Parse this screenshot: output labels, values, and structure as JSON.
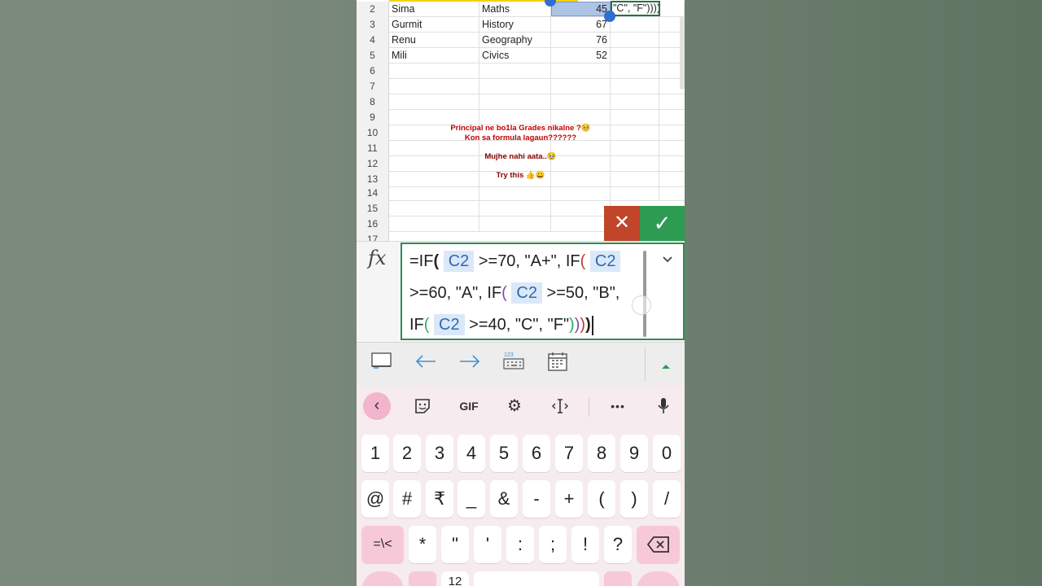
{
  "sheet": {
    "rows": [
      {
        "num": "2",
        "a": "Sima",
        "b": "Maths",
        "c": "45",
        "d": "\"C\", \"F\"))))"
      },
      {
        "num": "3",
        "a": "Gurmit",
        "b": "History",
        "c": "67",
        "d": ""
      },
      {
        "num": "4",
        "a": "Renu",
        "b": "Geography",
        "c": "76",
        "d": ""
      },
      {
        "num": "5",
        "a": "Mili",
        "b": "Civics",
        "c": "52",
        "d": ""
      },
      {
        "num": "6"
      },
      {
        "num": "7"
      },
      {
        "num": "8"
      },
      {
        "num": "9"
      },
      {
        "num": "10"
      },
      {
        "num": "11"
      },
      {
        "num": "12"
      },
      {
        "num": "13"
      },
      {
        "num": "14"
      },
      {
        "num": "15"
      },
      {
        "num": "16"
      },
      {
        "num": "17"
      }
    ],
    "notes": {
      "line1": "Principal ne bo1la Grades nikalne ?🥺",
      "line2": "Kon sa formula lagaun??????",
      "line3": "Mujhe nahi aata..🥹",
      "line4": "Try this 👍😀"
    }
  },
  "actions": {
    "cancel_icon": "✕",
    "enter_icon": "✓"
  },
  "formula": {
    "fx_label": "fx",
    "segments": {
      "s1": "=IF",
      "p1": "(",
      "ref1": "C2",
      "s2": ">=70, \"A+\", IF",
      "p2": "(",
      "ref2": "C2",
      "s3": ">=60, \"A\", IF",
      "p3": "(",
      "ref3": "C2",
      "s4": ">=50, \"B\",",
      "s5": "IF",
      "p4": "(",
      "ref4": "C2",
      "s6": ">=40, \"C\", \"F\"",
      "c4": ")",
      "c3": ")",
      "c2": ")",
      "c1": ")"
    },
    "expand_icon": "chevron-down"
  },
  "toolbar": {
    "items": [
      "select-cell-icon",
      "arrow-left-icon",
      "arrow-right-icon",
      "numeric-keypad-icon",
      "calendar-icon",
      "collapse-up-icon"
    ],
    "numpad_label": "123"
  },
  "keyboard": {
    "suggestion_bar": {
      "gif_label": "GIF",
      "more_label": "•••"
    },
    "number_row": [
      "1",
      "2",
      "3",
      "4",
      "5",
      "6",
      "7",
      "8",
      "9",
      "0"
    ],
    "symbol_row": [
      "@",
      "#",
      "₹",
      "_",
      "&",
      "-",
      "+",
      "(",
      ")",
      "/"
    ],
    "third_row": {
      "switch_label": "=\\<",
      "keys": [
        "*",
        "\"",
        "'",
        ":",
        ";",
        "!",
        "?"
      ]
    },
    "bottom_row": {
      "mode_label": "12"
    }
  },
  "colors": {
    "excel_green": "#2e9b52",
    "cancel_red": "#c0452b",
    "ref_blue": "#2f6ab3",
    "keyboard_pink": "#f7c9d8"
  }
}
